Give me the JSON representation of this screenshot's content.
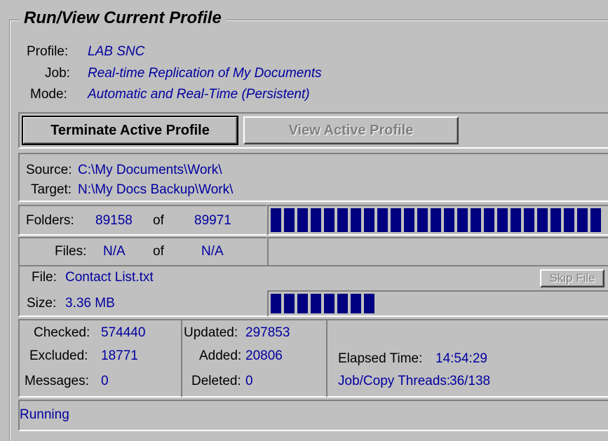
{
  "group_title": "Run/View Current Profile",
  "profile": {
    "label": "Profile:",
    "value": "LAB SNC"
  },
  "job": {
    "label": "Job:",
    "value": "Real-time Replication of My Documents"
  },
  "mode": {
    "label": "Mode:",
    "value": "Automatic and Real-Time (Persistent)"
  },
  "buttons": {
    "terminate": "Terminate Active Profile",
    "view": "View Active Profile",
    "skip": "Skip File"
  },
  "source": {
    "label": "Source:",
    "value": "C:\\My Documents\\Work\\"
  },
  "target": {
    "label": "Target:",
    "value": "N:\\My Docs Backup\\Work\\"
  },
  "folders": {
    "label": "Folders:",
    "done": "89158",
    "of": "of",
    "total": "89971",
    "progress": 0.99
  },
  "files": {
    "label": "Files:",
    "done": "N/A",
    "of": "of",
    "total": "N/A",
    "progress": 0
  },
  "file": {
    "label": "File:",
    "value": "Contact List.txt"
  },
  "size": {
    "label": "Size:",
    "value": "3.36 MB",
    "progress": 0.32
  },
  "stats": {
    "checked_label": "Checked:",
    "checked": "574440",
    "excluded_label": "Excluded:",
    "excluded": "18771",
    "messages_label": "Messages:",
    "messages": "0",
    "updated_label": "Updated:",
    "updated": "297853",
    "added_label": "Added:",
    "added": "20806",
    "deleted_label": "Deleted:",
    "deleted": "0",
    "elapsed_label": "Elapsed Time:",
    "elapsed": "14:54:29",
    "threads_label": "Job/Copy Threads:",
    "threads": "36/138"
  },
  "status": "Running",
  "colors": {
    "bar": "#000080",
    "value_text": "#0000a0",
    "face": "#c0c0c0"
  }
}
